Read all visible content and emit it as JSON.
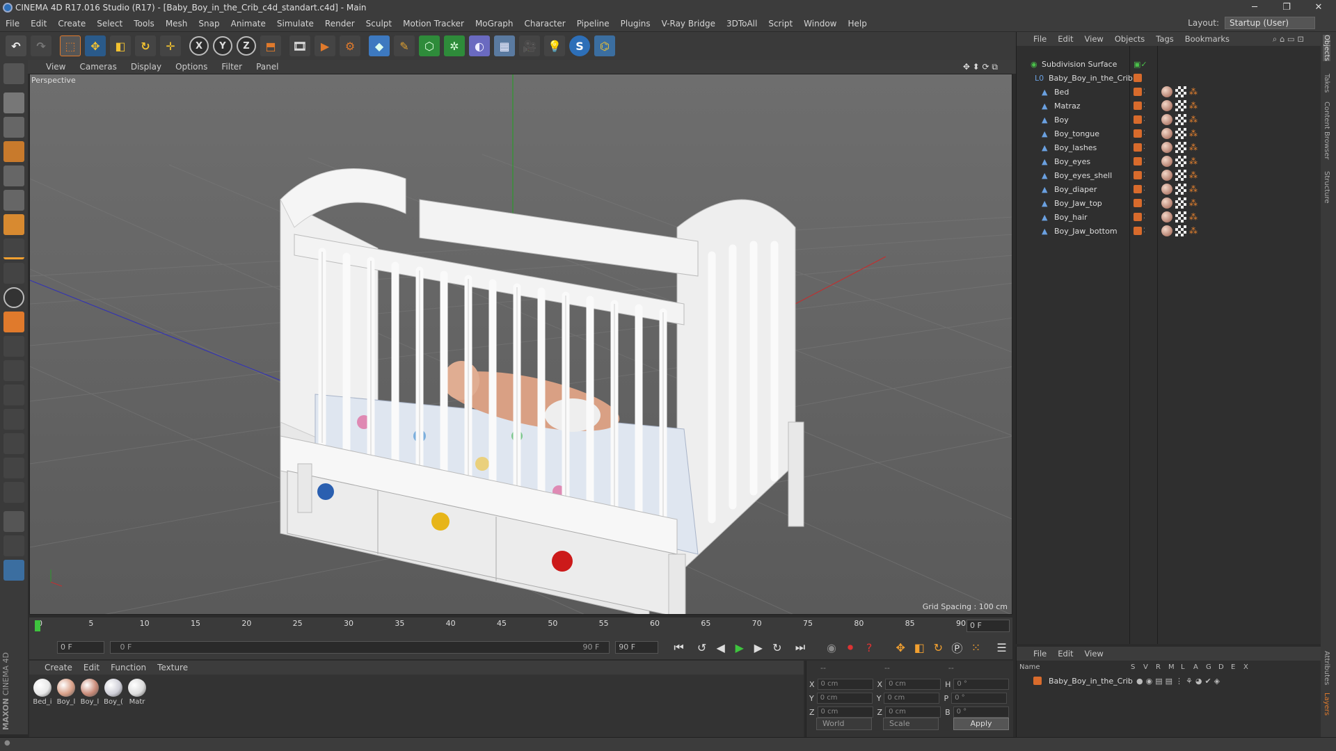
{
  "window": {
    "title": "CINEMA 4D R17.016 Studio (R17) - [Baby_Boy_in_the_Crib_c4d_standart.c4d] - Main",
    "minimize": "─",
    "maximize": "❐",
    "close": "✕"
  },
  "menubar": {
    "items": [
      "File",
      "Edit",
      "Create",
      "Select",
      "Tools",
      "Mesh",
      "Snap",
      "Animate",
      "Simulate",
      "Render",
      "Sculpt",
      "Motion Tracker",
      "MoGraph",
      "Character",
      "Pipeline",
      "Plugins",
      "V-Ray Bridge",
      "3DToAll",
      "Script",
      "Window",
      "Help"
    ],
    "layout_label": "Layout:",
    "layout_value": "Startup (User)"
  },
  "toolbar": {
    "icons": [
      "undo-icon",
      "redo-icon",
      "live-selection-icon",
      "move-icon",
      "scale-icon",
      "rotate-icon",
      "add-icon",
      "x-axis-icon",
      "y-axis-icon",
      "z-axis-icon",
      "coordinate-system-icon",
      "render-view-icon",
      "render-picture-viewer-icon",
      "render-settings-icon",
      "cube-icon",
      "pen-icon",
      "subdivision-icon",
      "array-icon",
      "deformer-icon",
      "floor-icon",
      "camera-icon",
      "light-icon",
      "cinema4d-icon",
      "python-icon"
    ],
    "x_label": "X",
    "y_label": "Y",
    "z_label": "Z"
  },
  "viewport": {
    "menu": [
      "View",
      "Cameras",
      "Display",
      "Options",
      "Filter",
      "Panel"
    ],
    "label": "Perspective",
    "grid_spacing": "Grid Spacing : 100 cm"
  },
  "timeline": {
    "ticks": [
      "0",
      "5",
      "10",
      "15",
      "20",
      "25",
      "30",
      "35",
      "40",
      "45",
      "50",
      "55",
      "60",
      "65",
      "70",
      "75",
      "80",
      "85",
      "90"
    ],
    "current_frame": "0 F"
  },
  "transport": {
    "start_field": "0 F",
    "range_start": "0 F",
    "range_end": "90 F",
    "end_field": "90 F"
  },
  "materials": {
    "menu": [
      "Create",
      "Edit",
      "Function",
      "Texture"
    ],
    "items": [
      {
        "label": "Bed_i",
        "color": "#e8e8e8"
      },
      {
        "label": "Boy_l",
        "color": "#d9a088"
      },
      {
        "label": "Boy_l",
        "color": "#c98a78"
      },
      {
        "label": "Boy_(",
        "color": "#cfcfd8"
      },
      {
        "label": "Matr",
        "color": "#dcdcdc"
      }
    ]
  },
  "coordinates": {
    "header": [
      "--",
      "--",
      "--"
    ],
    "rows": [
      {
        "a": "X",
        "av": "0 cm",
        "b": "X",
        "bv": "0 cm",
        "c": "H",
        "cv": "0 °"
      },
      {
        "a": "Y",
        "av": "0 cm",
        "b": "Y",
        "bv": "0 cm",
        "c": "P",
        "cv": "0 °"
      },
      {
        "a": "Z",
        "av": "0 cm",
        "b": "Z",
        "bv": "0 cm",
        "c": "B",
        "cv": "0 °"
      }
    ],
    "world": "World",
    "scale": "Scale",
    "apply": "Apply"
  },
  "objects": {
    "menu": [
      "File",
      "Edit",
      "View",
      "Objects",
      "Tags",
      "Bookmarks"
    ],
    "root": "Subdivision Surface",
    "group": "Baby_Boy_in_the_Crib",
    "items": [
      "Bed",
      "Matraz",
      "Boy",
      "Boy_tongue",
      "Boy_lashes",
      "Boy_eyes",
      "Boy_eyes_shell",
      "Boy_diaper",
      "Boy_Jaw_top",
      "Boy_hair",
      "Boy_Jaw_bottom"
    ]
  },
  "attributes": {
    "menu": [
      "File",
      "Edit",
      "View"
    ],
    "columns": [
      "Name",
      "S",
      "V",
      "R",
      "M",
      "L",
      "A",
      "G",
      "D",
      "E",
      "X"
    ],
    "row": "Baby_Boy_in_the_Crib"
  },
  "right_tabs": [
    "Objects",
    "Takes",
    "Content Browser",
    "Structure",
    "Attributes",
    "Layers"
  ],
  "branding": {
    "maxon": "MAXON",
    "cinema": "CINEMA 4D"
  }
}
